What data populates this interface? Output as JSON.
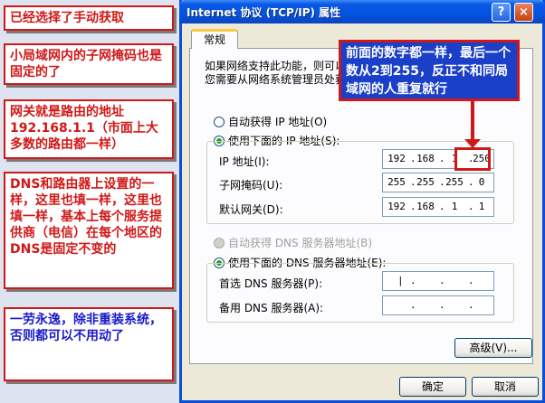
{
  "notes": {
    "note1": "已经选择了手动获取",
    "note2": "小局域网内的子网掩码也是固定的了",
    "note3": "网关就是路由的地址192.168.1.1（市面上大多数的路由都一样）",
    "note4": "DNS和路由器上设置的一样，这里也填一样，这里也填一样，基本上每个服务提供商（电信）在每个地区的DNS是固定不变的",
    "note5": "一劳永逸，除非重装系统，否则都可以不用动了"
  },
  "dialog": {
    "title": "Internet 协议 (TCP/IP) 属性",
    "help_btn": "?",
    "close_btn": "×",
    "tab": "常规",
    "desc_line1": "如果网络支持此功能，则可以获取自动指派的 IP 设置。否则，",
    "desc_line2": "您需要从网络系统管理员处获得适当的 IP 设置。",
    "radio_auto_ip": "自动获得 IP 地址(O)",
    "radio_manual_ip": "使用下面的 IP 地址(S):",
    "label_ip": "IP 地址(I):",
    "label_mask": "子网掩码(U):",
    "label_gateway": "默认网关(D):",
    "ip": [
      "192",
      "168",
      "1",
      "250"
    ],
    "mask": [
      "255",
      "255",
      "255",
      "0"
    ],
    "gateway": [
      "192",
      "168",
      "1",
      "1"
    ],
    "radio_auto_dns": "自动获得 DNS 服务器地址(B)",
    "radio_manual_dns": "使用下面的 DNS 服务器地址(E):",
    "label_dns1": "首选 DNS 服务器(P):",
    "label_dns2": "备用 DNS 服务器(A):",
    "advanced": "高级(V)...",
    "ok": "确定",
    "cancel": "取消"
  },
  "callout": "前面的数字都一样，最后一个数从2到255，反正不和同局域网的人重复就行",
  "colors": {
    "note_border": "#d01818",
    "note_text_red": "#d01818",
    "note_text_blue": "#1a1acc",
    "callout_bg": "#1a3fc8",
    "titlebar": "#0454df"
  }
}
